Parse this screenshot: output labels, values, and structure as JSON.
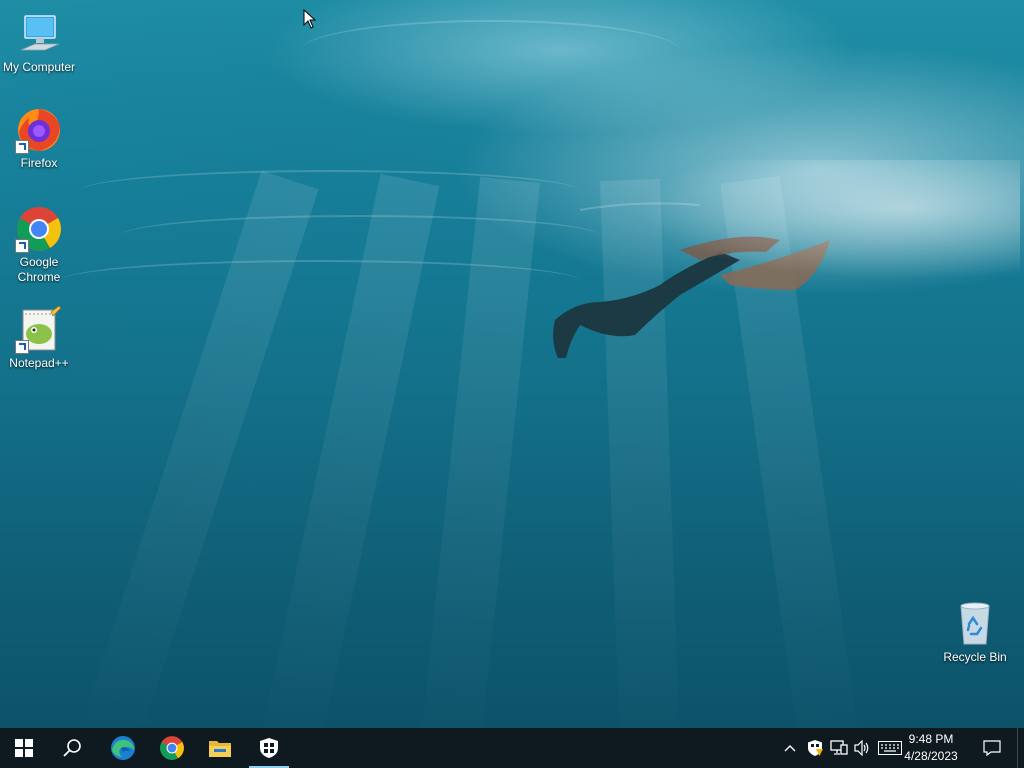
{
  "desktop": {
    "icons": [
      {
        "label": "My Computer",
        "icon": "computer-icon"
      },
      {
        "label": "Firefox",
        "icon": "firefox-icon"
      },
      {
        "label": "Google Chrome",
        "icon": "chrome-icon"
      },
      {
        "label": "Notepad++",
        "icon": "notepad-plus-plus-icon"
      },
      {
        "label": "Recycle Bin",
        "icon": "recycle-bin-icon"
      }
    ]
  },
  "taskbar": {
    "pinned": [
      {
        "icon": "windows-start-icon"
      },
      {
        "icon": "search-icon"
      },
      {
        "icon": "edge-icon"
      },
      {
        "icon": "chrome-icon"
      },
      {
        "icon": "file-explorer-icon"
      },
      {
        "icon": "windows-security-icon"
      }
    ],
    "tray": {
      "icons": [
        "chevron-up-icon",
        "security-warning-icon",
        "network-icon",
        "volume-icon",
        "keyboard-icon"
      ],
      "time": "9:48 PM",
      "date": "4/28/2023"
    },
    "colors": {
      "background": "#0f1a20",
      "active_indicator": "#8ecff0"
    }
  }
}
